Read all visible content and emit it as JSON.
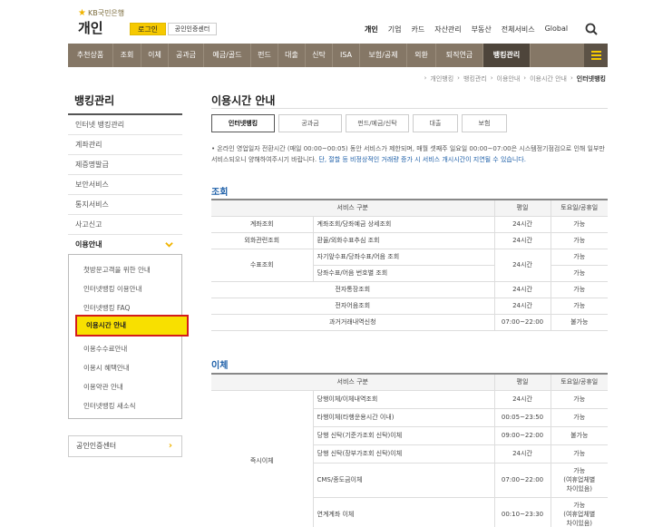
{
  "header": {
    "brand_small": "KB국민은행",
    "brand_big": "개인",
    "login": "로그인",
    "cert_center": "공인인증센터",
    "top_links": [
      "개인",
      "기업",
      "카드",
      "자산관리",
      "부동산",
      "전체서비스",
      "Global"
    ]
  },
  "gnb": {
    "items": [
      "추천상품",
      "조회",
      "이체",
      "공과금",
      "예금/골드",
      "펀드",
      "대출",
      "신탁",
      "ISA",
      "보험/공제",
      "외환",
      "퇴직연금",
      "뱅킹관리"
    ]
  },
  "breadcrumb": [
    "개인뱅킹",
    "뱅킹관리",
    "이용안내",
    "이용시간 안내",
    "인터넷뱅킹"
  ],
  "sidebar": {
    "title": "뱅킹관리",
    "items": [
      "인터넷 뱅킹관리",
      "계좌관리",
      "제증명발급",
      "보안서비스",
      "통지서비스",
      "사고신고",
      "이용안내"
    ],
    "submenu": [
      "첫방문고객을 위한 안내",
      "인터넷뱅킹 이용안내",
      "인터넷뱅킹 FAQ",
      "이용시간 안내",
      "이용수수료안내",
      "이용시 혜택안내",
      "이용약관 안내",
      "인터넷뱅킹 새소식"
    ],
    "cert": "공인인증센터"
  },
  "main": {
    "title": "이용시간 안내",
    "tabs": [
      "인터넷뱅킹",
      "공과금",
      "펀드/예금/신탁",
      "대출",
      "보험"
    ],
    "notice_1": "온라인 영업일자 전환시간 (매일 00:00~00:05) 동안 서비스가 제한되며, 매월 셋째주 일요일 00:00~07:00은 시스템정기점검으로 인해 일부만 서비스되오니 양해하여주시기 바랍니다.",
    "notice_2": "단, 절할 등 비정상적인 거래량 증가 시 서비스 개시시간이 지연될 수 있습니다."
  },
  "inquiry": {
    "title": "조회",
    "headers": [
      "서비스 구분",
      "평일",
      "토요일/공휴일"
    ],
    "rows": {
      "r1": {
        "cat": "계좌조회",
        "svc": "계좌조회/당좌예금 상세조회",
        "wd": "24시간",
        "we": "가능"
      },
      "r2": {
        "cat": "외화관련조회",
        "svc": "환율/외화수표추심 조회",
        "wd": "24시간",
        "we": "가능"
      },
      "r3": {
        "cat": "수표조회",
        "svc": "자기앞수표/당좌수표/어음 조회",
        "wd": "24시간",
        "we": "가능"
      },
      "r4": {
        "svc": "당좌수표/어음 번호별 조회",
        "we": "가능"
      },
      "r5": {
        "svc": "전자통장조회",
        "wd": "24시간",
        "we": "가능"
      },
      "r6": {
        "svc": "전자어음조회",
        "wd": "24시간",
        "we": "가능"
      },
      "r7": {
        "svc": "과거거래내역신청",
        "wd": "07:00~22:00",
        "we": "불가능"
      }
    }
  },
  "transfer": {
    "title": "이체",
    "headers": [
      "서비스 구분",
      "평일",
      "토요일/공휴일"
    ],
    "cat": "즉시이체",
    "rows": {
      "r1": {
        "svc": "당행이체/이체내역조회",
        "wd": "24시간",
        "we": "가능"
      },
      "r2": {
        "svc": "타행이체(타행운용시간 이내)",
        "wd": "00:05~23:50",
        "we": "가능"
      },
      "r3": {
        "svc": "당행 신탁(기준가조회 신탁)이체",
        "wd": "09:00~22:00",
        "we": "불가능"
      },
      "r4": {
        "svc": "당행 신탁(장부가조회 신탁)이체",
        "wd": "24시간",
        "we": "가능"
      },
      "r5": {
        "svc": "CMS/종도금이체",
        "wd": "07:00~22:00",
        "we_1": "가능",
        "we_2": "(여휴업체별",
        "we_3": "차이있음)"
      },
      "r6": {
        "svc": "연계계좌 이체",
        "wd": "00:10~23:30",
        "we_1": "가능",
        "we_2": "(여휴업체별",
        "we_3": "차이있음)"
      }
    }
  }
}
